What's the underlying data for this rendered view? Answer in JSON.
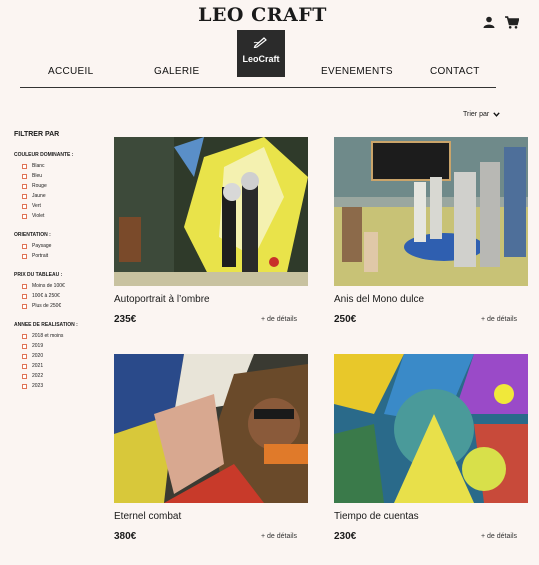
{
  "header": {
    "brand": "LEO CRAFT",
    "logo_text": "LeoCraft",
    "icons": [
      "user-icon",
      "cart-icon"
    ]
  },
  "nav": [
    "ACCUEIL",
    "GALERIE",
    "EVENEMENTS",
    "CONTACT"
  ],
  "sort": {
    "label": "Trier par"
  },
  "filters": {
    "title": "FILTRER PAR",
    "groups": [
      {
        "title": "COULEUR DOMINANTE :",
        "options": [
          "Blanc",
          "Bleu",
          "Rouge",
          "Jaune",
          "Vert",
          "Violet"
        ]
      },
      {
        "title": "ORIENTATION :",
        "options": [
          "Paysage",
          "Portrait"
        ]
      },
      {
        "title": "PRIX DU TABLEAU :",
        "options": [
          "Moins de 100€",
          "100€ à 250€",
          "Plus de 250€"
        ]
      },
      {
        "title": "ANNEE DE REALISATION :",
        "options": [
          "2018 et moins",
          "2019",
          "2020",
          "2021",
          "2022",
          "2023"
        ]
      }
    ]
  },
  "products": [
    {
      "title": "Autoportrait à l’ombre",
      "price": "235€",
      "more": "+ de détails"
    },
    {
      "title": "Anis del Mono dulce",
      "price": "250€",
      "more": "+ de détails"
    },
    {
      "title": "Eternel combat",
      "price": "380€",
      "more": "+ de détails"
    },
    {
      "title": "Tiempo de cuentas",
      "price": "230€",
      "more": "+ de détails"
    }
  ],
  "colors": {
    "background": "#fbf5f2",
    "checkbox_border": "#e07355",
    "logo_bg": "#2b2b2b"
  }
}
